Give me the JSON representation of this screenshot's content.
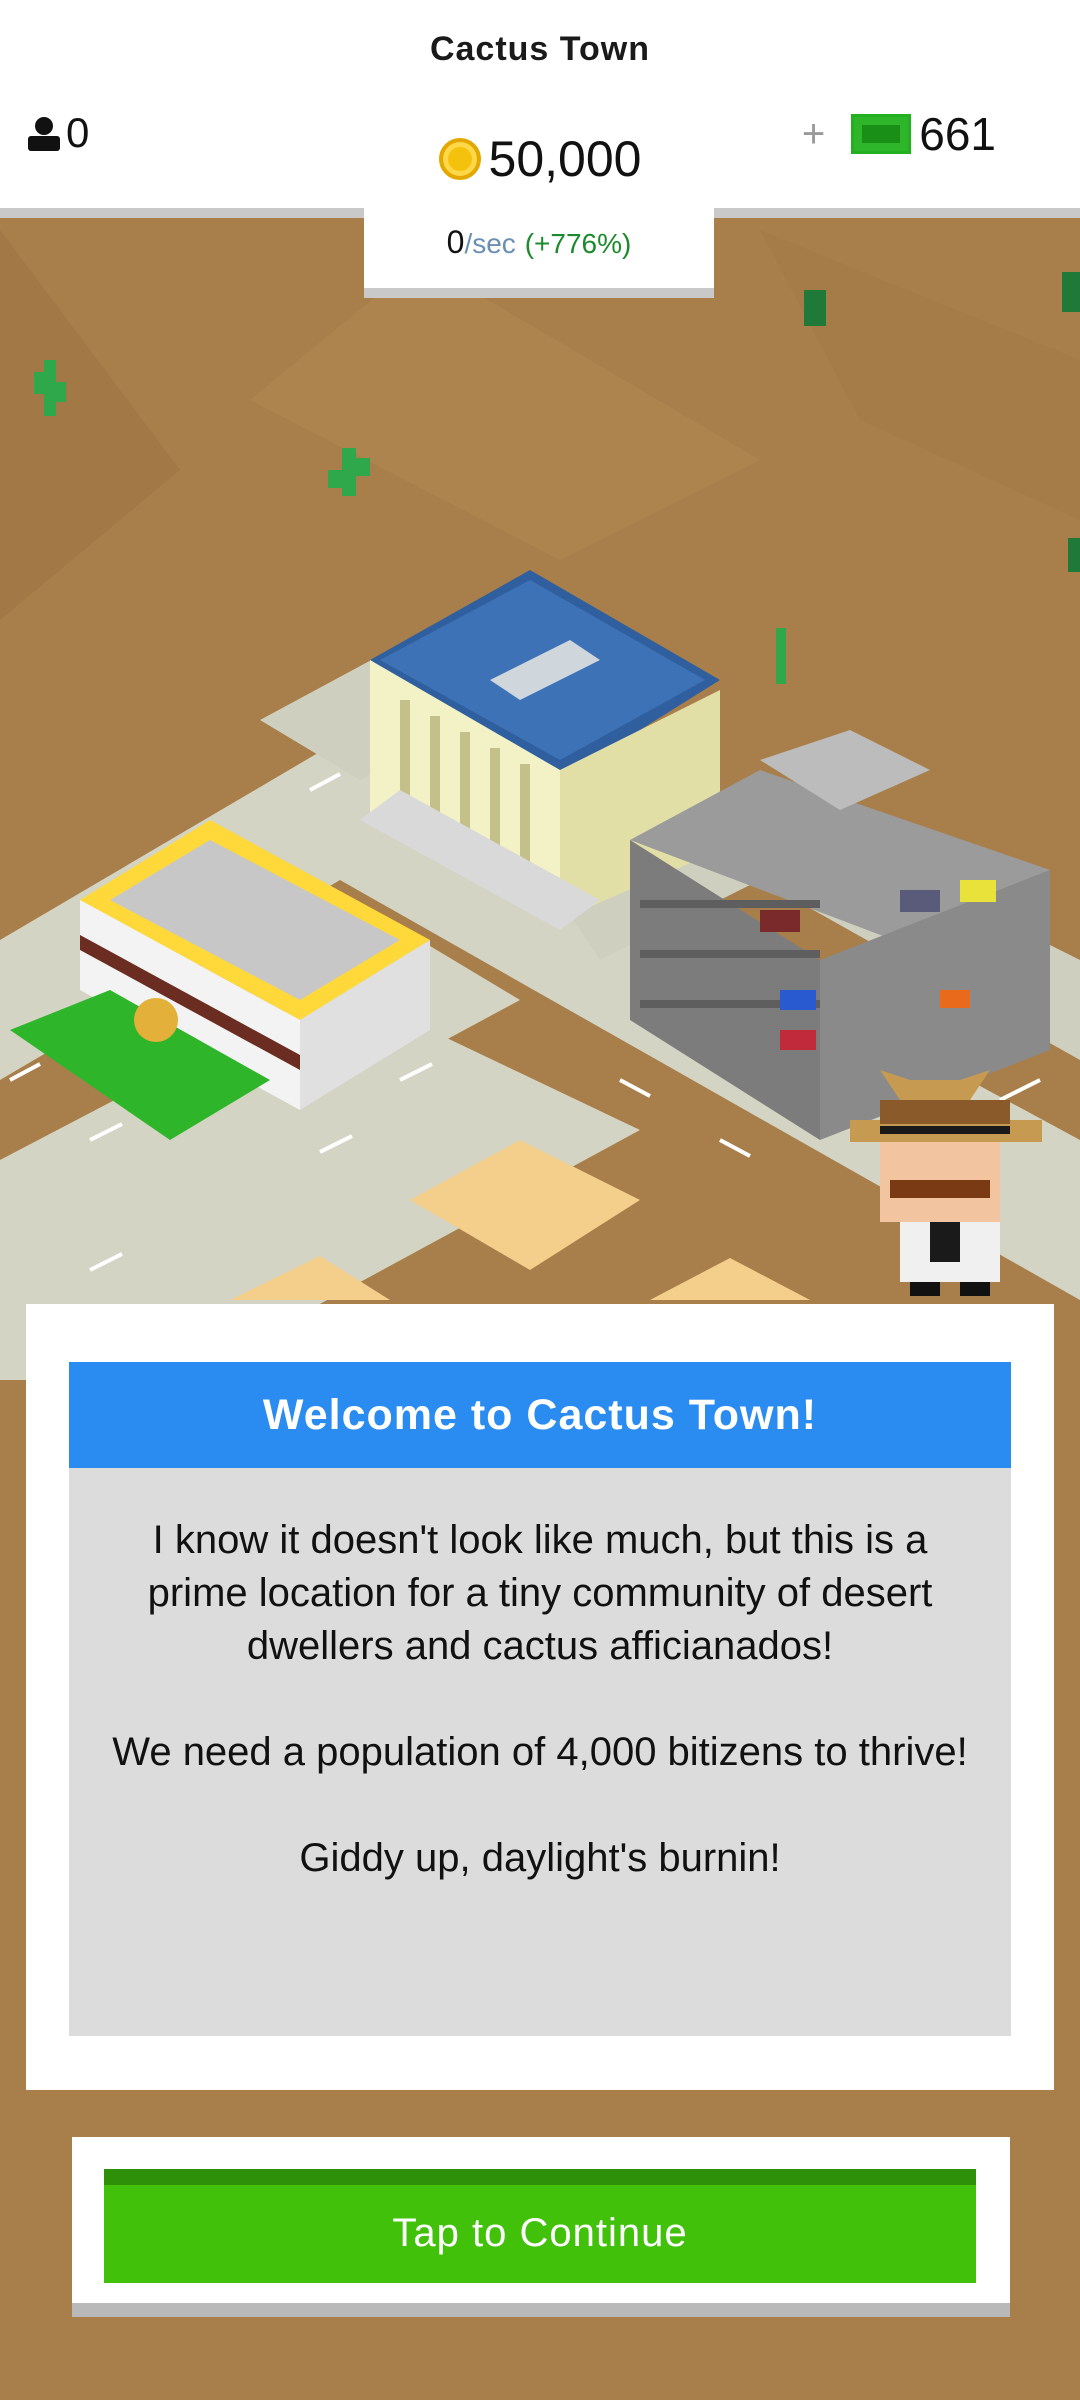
{
  "hud": {
    "town_name": "Cactus Town",
    "population": "0",
    "coins": "50,000",
    "rate_value": "0",
    "rate_unit": "/sec",
    "rate_bonus": "(+776%)",
    "plus_label": "+",
    "cash": "661"
  },
  "dialog": {
    "title": "Welcome to Cactus Town!",
    "paragraph_1": "I know it doesn't look like much, but this is a prime location for a tiny community of desert dwellers and cactus afficianados!",
    "paragraph_2": "We need a population of 4,000 bitizens to thrive!",
    "paragraph_3": "Giddy up, daylight's burnin!"
  },
  "continue_button": {
    "label": "Tap to Continue"
  },
  "colors": {
    "desert": "#a87f4a",
    "header_blue": "#2a8cf0",
    "button_green": "#42c10a",
    "dialog_body_gray": "#dcdcdc"
  },
  "icons": [
    "person-icon",
    "coin-icon",
    "cash-bill-icon",
    "plus-icon"
  ]
}
